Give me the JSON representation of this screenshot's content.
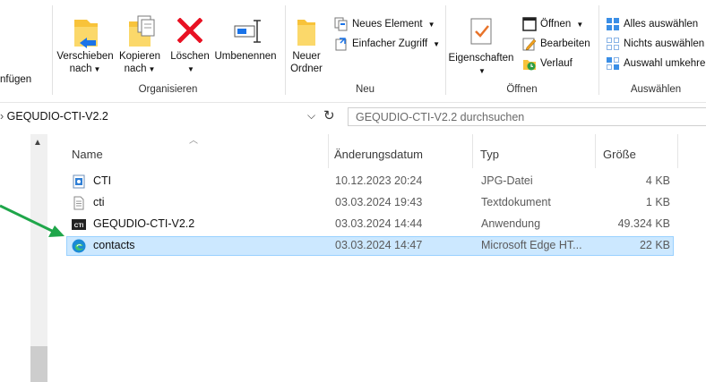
{
  "ribbon": {
    "paste_partial_label": "nfügen",
    "move_to_label": "Verschieben",
    "move_to_sub": "nach",
    "copy_to_label": "Kopieren",
    "copy_to_sub": "nach",
    "delete_label": "Löschen",
    "rename_label": "Umbenennen",
    "new_folder_label": "Neuer",
    "new_folder_sub": "Ordner",
    "new_item_label": "Neues Element",
    "easy_access_label": "Einfacher Zugriff",
    "properties_label": "Eigenschaften",
    "open_label": "Öffnen",
    "edit_label": "Bearbeiten",
    "history_label": "Verlauf",
    "select_all_label": "Alles auswählen",
    "select_none_label": "Nichts auswählen",
    "invert_selection_label": "Auswahl umkehre",
    "groups": {
      "organize": "Organisieren",
      "new": "Neu",
      "open": "Öffnen",
      "select": "Auswählen"
    }
  },
  "address": {
    "breadcrumb": "GEQUDIO-CTI-V2.2",
    "search_placeholder": "GEQUDIO-CTI-V2.2 durchsuchen"
  },
  "columns": {
    "name": "Name",
    "date": "Änderungsdatum",
    "type": "Typ",
    "size": "Größe"
  },
  "files": [
    {
      "name": "CTI",
      "date": "10.12.2023 20:24",
      "type": "JPG-Datei",
      "size": "4 KB",
      "icon": "image-file-icon"
    },
    {
      "name": "cti",
      "date": "03.03.2024 19:43",
      "type": "Textdokument",
      "size": "1 KB",
      "icon": "text-file-icon"
    },
    {
      "name": "GEQUDIO-CTI-V2.2",
      "date": "03.03.2024 14:44",
      "type": "Anwendung",
      "size": "49.324 KB",
      "icon": "application-icon"
    },
    {
      "name": "contacts",
      "date": "03.03.2024 14:47",
      "type": "Microsoft Edge HT...",
      "size": "22 KB",
      "icon": "edge-html-icon",
      "selected": true
    }
  ],
  "colors": {
    "selection_bg": "#cce8ff",
    "selection_border": "#99d1ff",
    "arrow": "#1fa64a",
    "delete_red": "#e81123",
    "folder_yellow": "#f8c33a",
    "accent_blue": "#1a73e8"
  }
}
